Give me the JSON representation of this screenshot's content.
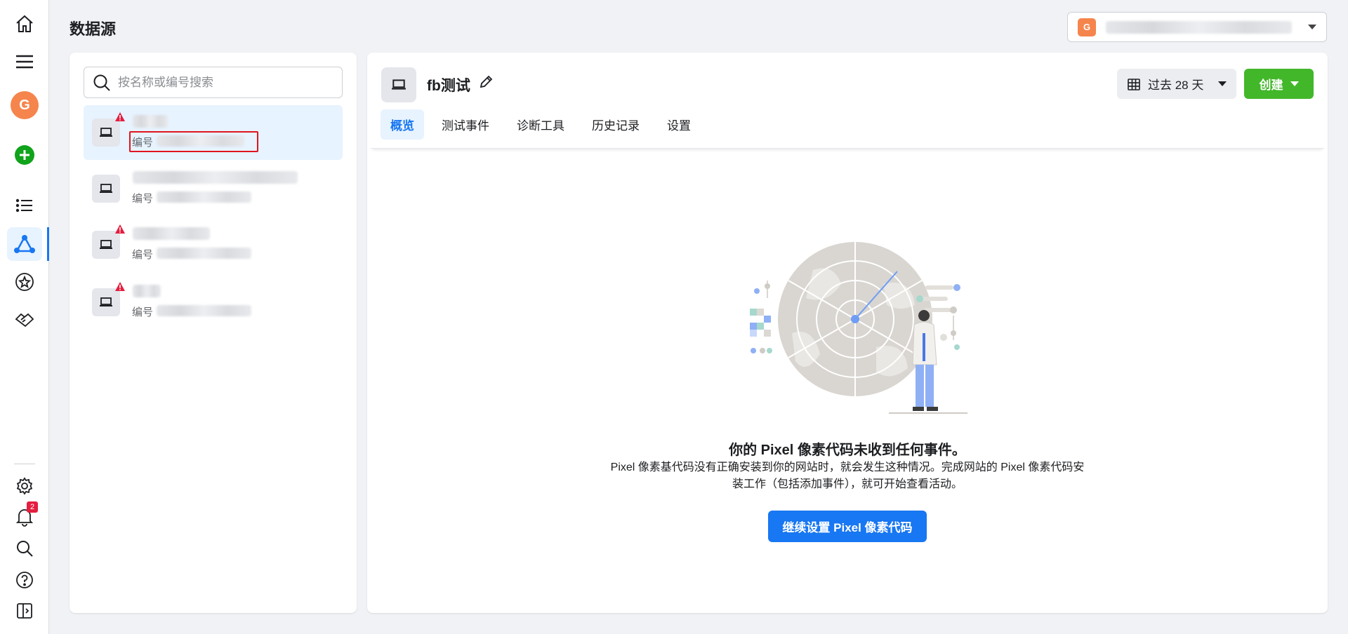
{
  "page": {
    "title": "数据源"
  },
  "rail": {
    "notification_count": "2",
    "avatar_letter": "G"
  },
  "account": {
    "letter": "G"
  },
  "search": {
    "placeholder": "按名称或编号搜索"
  },
  "sources": [
    {
      "id_label": "编号",
      "warning": true,
      "selected": true
    },
    {
      "id_label": "编号",
      "warning": false,
      "selected": false
    },
    {
      "id_label": "编号",
      "warning": true,
      "selected": false
    },
    {
      "id_label": "编号",
      "warning": true,
      "selected": false
    }
  ],
  "detail": {
    "name": "fb测试",
    "date_range": "过去 28 天",
    "create_label": "创建",
    "tabs": [
      "概览",
      "测试事件",
      "诊断工具",
      "历史记录",
      "设置"
    ],
    "active_tab": "概览",
    "empty_title": "你的 Pixel 像素代码未收到任何事件。",
    "empty_desc": "Pixel 像素基代码没有正确安装到你的网站时，就会发生这种情况。完成网站的 Pixel 像素代码安装工作（包括添加事件），就可开始查看活动。",
    "cta_label": "继续设置 Pixel 像素代码"
  },
  "colors": {
    "accent": "#1877f2",
    "create": "#42b72a",
    "avatar": "#f5854c",
    "warning": "#e41e3f"
  }
}
